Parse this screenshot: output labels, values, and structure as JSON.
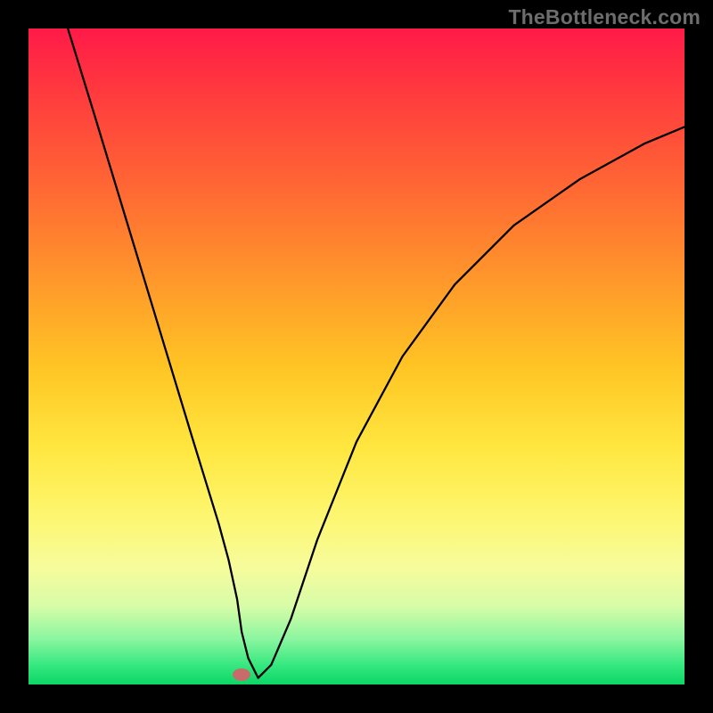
{
  "watermark": "TheBottleneck.com",
  "chart_data": {
    "type": "line",
    "title": "",
    "xlabel": "",
    "ylabel": "",
    "xlim": [
      0,
      100
    ],
    "ylim": [
      0,
      100
    ],
    "grid": false,
    "series": [
      {
        "name": "curve",
        "x": [
          6,
          10,
          15,
          20,
          25,
          27,
          29,
          30.5,
          31.8,
          32.5,
          33.5,
          35,
          37,
          40,
          44,
          50,
          57,
          65,
          74,
          84,
          94,
          100
        ],
        "y": [
          100,
          87,
          70.5,
          54,
          37.5,
          31,
          24.5,
          19,
          13,
          8,
          4,
          1,
          3,
          10,
          22,
          37,
          50,
          61,
          70,
          77,
          82.5,
          85
        ]
      }
    ],
    "marker": {
      "x": 32.5,
      "y": 1.5,
      "color": "#c86b6b"
    },
    "background_gradient": {
      "top": "#ff1a48",
      "bottom": "#0cd665"
    }
  }
}
